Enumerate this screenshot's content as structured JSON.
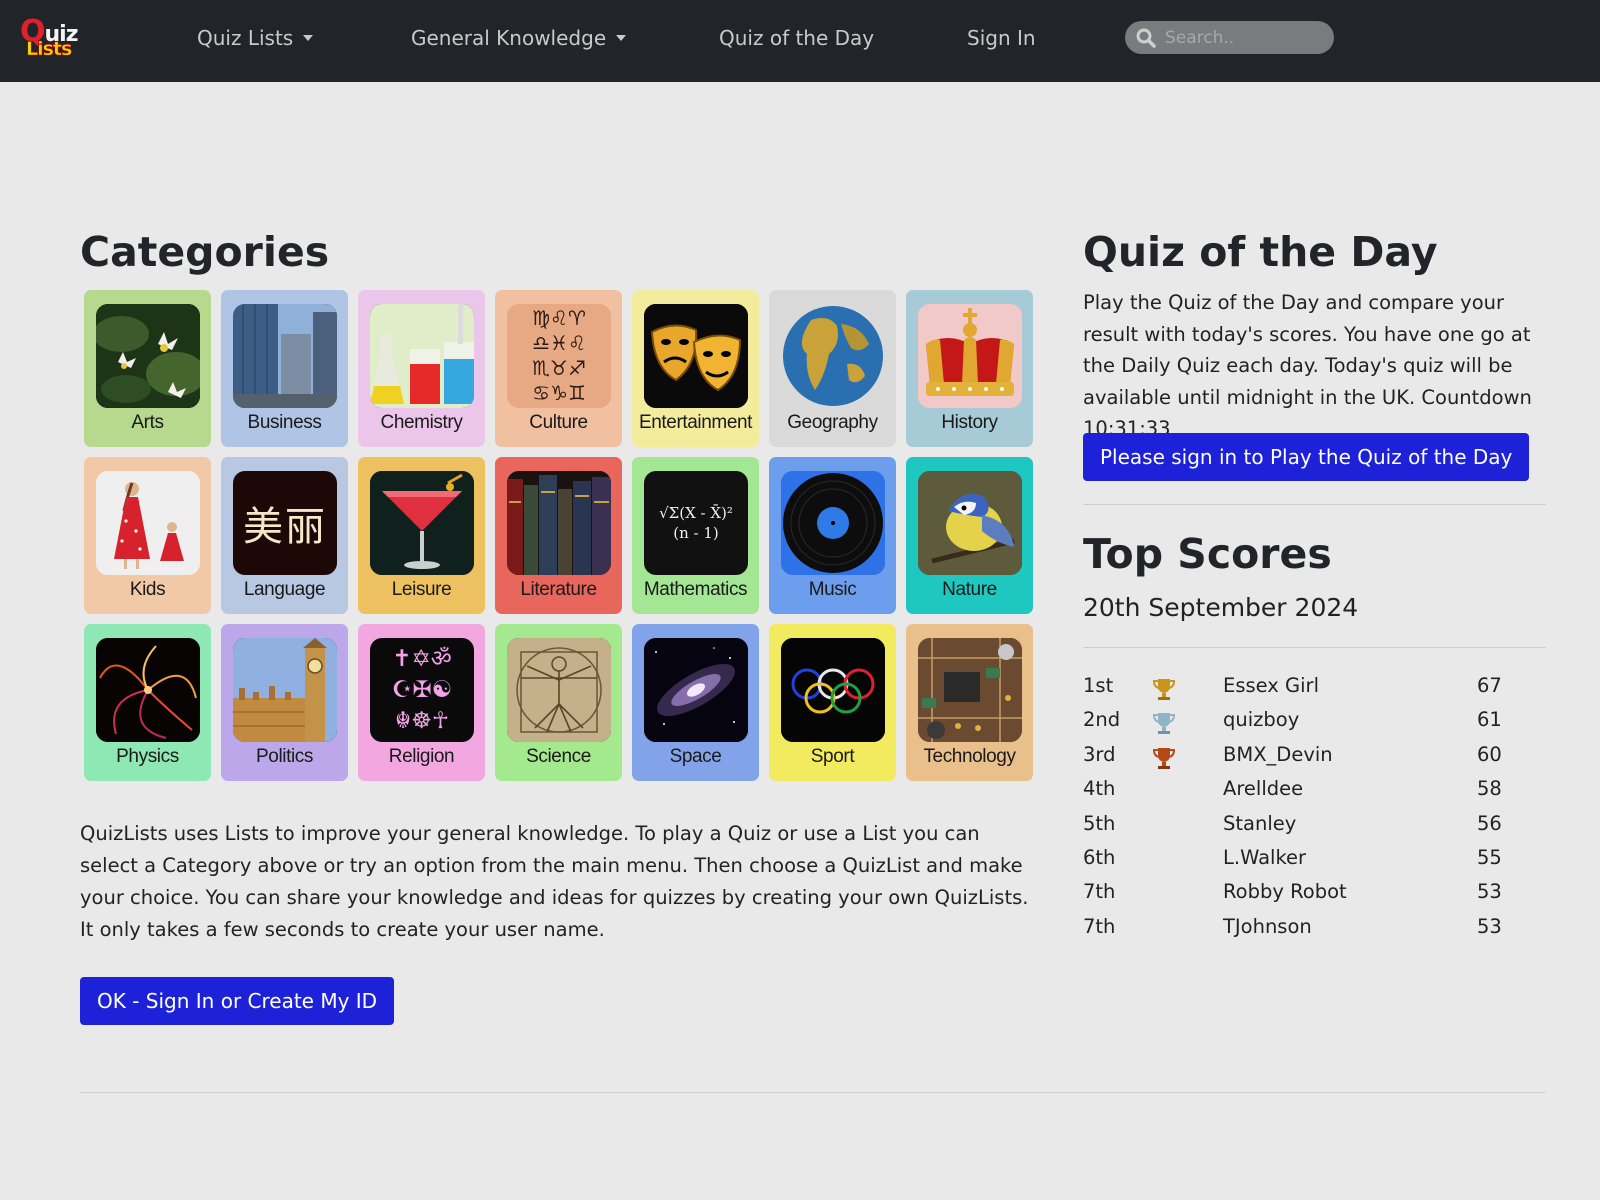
{
  "nav": {
    "logo_top": "uiz",
    "logo_q": "Q",
    "logo_bottom": "Lists",
    "items": [
      {
        "label": "Quiz Lists",
        "dropdown": true
      },
      {
        "label": "General Knowledge",
        "dropdown": true
      },
      {
        "label": "Quiz of the Day",
        "dropdown": false
      },
      {
        "label": "Sign In",
        "dropdown": false
      }
    ],
    "search_placeholder": "Search.."
  },
  "categories": {
    "title": "Categories",
    "tiles": [
      {
        "label": "Arts",
        "bg": "#b6d98d"
      },
      {
        "label": "Business",
        "bg": "#b0c4e6"
      },
      {
        "label": "Chemistry",
        "bg": "#ecc6ea"
      },
      {
        "label": "Culture",
        "bg": "#f0c0a0"
      },
      {
        "label": "Entertainment",
        "bg": "#f2ec9c"
      },
      {
        "label": "Geography",
        "bg": "#dadada"
      },
      {
        "label": "History",
        "bg": "#a7cbd6"
      },
      {
        "label": "Kids",
        "bg": "#f2c9a6"
      },
      {
        "label": "Language",
        "bg": "#b8c7e2"
      },
      {
        "label": "Leisure",
        "bg": "#eec160"
      },
      {
        "label": "Literature",
        "bg": "#e9665d"
      },
      {
        "label": "Mathematics",
        "bg": "#a3e694"
      },
      {
        "label": "Music",
        "bg": "#6d9ded"
      },
      {
        "label": "Nature",
        "bg": "#1ec7bf"
      },
      {
        "label": "Physics",
        "bg": "#8ee8b4"
      },
      {
        "label": "Politics",
        "bg": "#bca7ea"
      },
      {
        "label": "Religion",
        "bg": "#f2a7e1"
      },
      {
        "label": "Science",
        "bg": "#a5e98f"
      },
      {
        "label": "Space",
        "bg": "#82a3ea"
      },
      {
        "label": "Sport",
        "bg": "#f2ea5f"
      },
      {
        "label": "Technology",
        "bg": "#e9bf8c"
      }
    ],
    "symbols": {
      "culture": "♍♌♈\n♎♓♌\n♏♉♐\n♋♑♊",
      "language": "美丽",
      "mathematics": "√Σ(X - X̄)²\n(n - 1)",
      "religion": "✝✡ॐ\n☪✠☯\n☬☸☥"
    },
    "intro": "QuizLists uses Lists to improve your general knowledge. To play a Quiz or use a List you can select a Category above or try an option from the main menu. Then choose a QuizList and make your choice. You can share your knowledge and ideas for quizzes by creating your own QuizLists. It only takes a few seconds to create your user name.",
    "signin_button": "OK - Sign In or Create My ID"
  },
  "qotd": {
    "title": "Quiz of the Day",
    "text": "Play the Quiz of the Day and compare your result with today's scores. You have one go at the Daily Quiz each day. Today's quiz will be available until midnight in the UK. Countdown 10:31:33",
    "button": "Please sign in to Play the Quiz of the Day"
  },
  "top_scores": {
    "title": "Top Scores",
    "date": "20th September 2024",
    "rows": [
      {
        "rank": "1st",
        "trophy": "gold",
        "trophy_color": "#c8961c",
        "name": "Essex Girl",
        "score": "67"
      },
      {
        "rank": "2nd",
        "trophy": "silver",
        "trophy_color": "#8fb4c7",
        "name": "quizboy",
        "score": "61"
      },
      {
        "rank": "3rd",
        "trophy": "bronze",
        "trophy_color": "#b24a17",
        "name": "BMX_Devin",
        "score": "60"
      },
      {
        "rank": "4th",
        "trophy": "",
        "trophy_color": "",
        "name": "Arelldee",
        "score": "58"
      },
      {
        "rank": "5th",
        "trophy": "",
        "trophy_color": "",
        "name": "Stanley",
        "score": "56"
      },
      {
        "rank": "6th",
        "trophy": "",
        "trophy_color": "",
        "name": "L.Walker",
        "score": "55"
      },
      {
        "rank": "7th",
        "trophy": "",
        "trophy_color": "",
        "name": "Robby Robot",
        "score": "53"
      },
      {
        "rank": "7th",
        "trophy": "",
        "trophy_color": "",
        "name": "TJohnson",
        "score": "53"
      }
    ]
  }
}
